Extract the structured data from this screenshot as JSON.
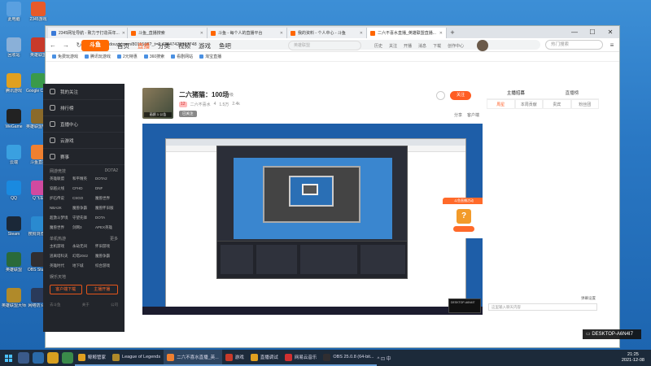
{
  "desktop": {
    "icons": [
      {
        "label": "此电脑",
        "color": "#5aa0e0"
      },
      {
        "label": "2345游戏",
        "color": "#e65a2a"
      },
      {
        "label": "回收站",
        "color": "#8ab0d8"
      },
      {
        "label": "英雄联盟",
        "color": "#c83a2a"
      },
      {
        "label": "腾讯游戏",
        "color": "#e0a020"
      },
      {
        "label": "Google Chrome",
        "color": "#3a9a4a"
      },
      {
        "label": "WeGame",
        "color": "#222222"
      },
      {
        "label": "英雄联盟WeGame版",
        "color": "#8a6a2a"
      },
      {
        "label": "云端",
        "color": "#3aa0e0"
      },
      {
        "label": "斗鱼直播",
        "color": "#f08030"
      },
      {
        "label": "QQ",
        "color": "#1a8ae0"
      },
      {
        "label": "Q飞车",
        "color": "#d04aa0"
      },
      {
        "label": "Steam",
        "color": "#1b2838"
      },
      {
        "label": "搜狗浏览器",
        "color": "#2a8ad0"
      },
      {
        "label": "英雄联盟",
        "color": "#2a6a3a"
      },
      {
        "label": "OBS Studio",
        "color": "#302e31"
      },
      {
        "label": "英雄联盟大师",
        "color": "#b08a2a"
      },
      {
        "label": "网络防火墙",
        "color": "#2a3a5a"
      }
    ]
  },
  "browser": {
    "tabs": [
      {
        "title": "2345网址导航 - 致力于打造百年..."
      },
      {
        "title": "斗鱼_直播搜索"
      },
      {
        "title": "斗鱼 - 每个人的直播平台"
      },
      {
        "title": "我的资料 - 个人中心 - 斗鱼"
      },
      {
        "title": "二六不喜水直播_英雄联盟直播..."
      }
    ],
    "window_controls": {
      "minimize": "—",
      "maximize": "☐",
      "close": "✕"
    },
    "new_tab": "+",
    "url": "douyu.com/8011565?_t=0.42847428367748",
    "search_placeholder": "热门搜索",
    "bookmarks": [
      "免费玩游戏",
      "腾讯玩游戏",
      "2元特惠",
      "360搜索",
      "看剧网站",
      "淘宝直播"
    ]
  },
  "site": {
    "logo": "斗鱼",
    "nav": [
      "首页",
      "直播",
      "分类",
      "视频",
      "游戏",
      "鱼吧"
    ],
    "active_nav": "直播",
    "search_placeholder": "英雄联盟",
    "icons": [
      "历史",
      "关注",
      "开播",
      "消息",
      "下载",
      "创作中心"
    ]
  },
  "sidenav": {
    "rows": [
      "我的关注",
      "排行榜",
      "直播中心",
      "云游戏",
      "赛事"
    ],
    "game_section": "网游竞技",
    "game_sub": [
      "DOTA2"
    ],
    "games": [
      "英雄联盟",
      "和平精英",
      "DOTA2",
      "穿越火线",
      "CFHD",
      "DNF",
      "炉石传说",
      "CSGO",
      "魔兽世界",
      "NBA2K",
      "魔兽争霸",
      "魔兽怀旧服",
      "超激斗梦境",
      "守望先锋",
      "DOTA",
      "魔兽世界",
      "剑网3",
      "APEX英雄"
    ],
    "single_section": "单机热游",
    "single_sub": [
      "更多"
    ],
    "singles": [
      "主机游戏",
      "永劫无间",
      "怀旧游戏",
      "逃离塔科夫",
      "幻塔2042",
      "魔兽争霸",
      "英雄时代",
      "地下城",
      "综合游戏"
    ],
    "more_section": "娱乐天地",
    "buttons": [
      "客户端下载",
      "主播开播"
    ],
    "footer": [
      "去斗鱼",
      "关于",
      "公司"
    ]
  },
  "room": {
    "title": "二六猪猫：100场",
    "tag": "等级",
    "level": "12",
    "anchor": "二六不喜水",
    "follows": "4",
    "heat": "2.4k",
    "views": "1.5万",
    "thumb_caption": "画质 1 公告",
    "status": "已关注",
    "follow_btn": "关注",
    "actions": [
      "分享",
      "客户端"
    ]
  },
  "player": {
    "card_title": "斗鱼直播活动",
    "card_glyph": "?",
    "popup": "DESKTOP-A6N4I7"
  },
  "chat": {
    "tabs": [
      "主播招募",
      "直播榜"
    ],
    "rank_tabs": [
      "周星",
      "本周贡献",
      "贵宾",
      "粉丝团"
    ],
    "hint": "弹幕设置",
    "input_placeholder": "这里输入聊天内容"
  },
  "toast": {
    "text": "DESKTOP-A6N4I7"
  },
  "taskbar": {
    "apps": [
      {
        "label": "鲸鲸管家",
        "color": "#e0a020",
        "active": false
      },
      {
        "label": "League of Legends",
        "color": "#b08a2a",
        "active": false
      },
      {
        "label": "二六不喜水直播_英...",
        "color": "#f08030",
        "active": true
      },
      {
        "label": "游戏",
        "color": "#c83a2a",
        "active": false
      },
      {
        "label": "直播调试",
        "color": "#e0a020",
        "active": false
      },
      {
        "label": "网易云音乐",
        "color": "#d03030",
        "active": false
      },
      {
        "label": "OBS 25.0.8 (64-bit...",
        "color": "#302e31",
        "active": false
      }
    ],
    "time": "21:25",
    "date": "2021-12-08",
    "tray": "^ ⊡ 中"
  }
}
